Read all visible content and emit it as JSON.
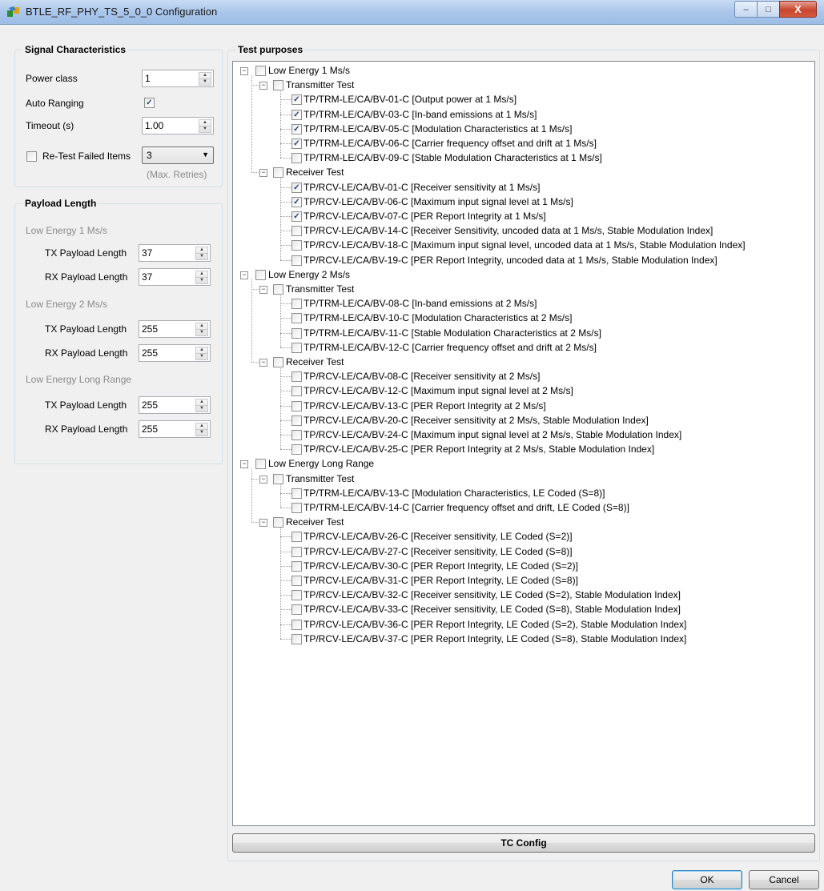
{
  "window": {
    "title": "BTLE_RF_PHY_TS_5_0_0 Configuration",
    "minimize": "–",
    "maximize": "□",
    "close": "X"
  },
  "signal": {
    "title": "Signal Characteristics",
    "power_class_label": "Power class",
    "power_class_value": "1",
    "auto_ranging_label": "Auto Ranging",
    "auto_ranging_checked": true,
    "timeout_label": "Timeout (s)",
    "timeout_value": "1.00",
    "retest_label": "Re-Test Failed Items",
    "retest_checked": false,
    "retest_value": "3",
    "max_retries": "(Max. Retries)"
  },
  "payload": {
    "title": "Payload Length",
    "groups": [
      {
        "name": "Low Energy 1 Ms/s",
        "tx_label": "TX Payload Length",
        "tx": "37",
        "rx_label": "RX Payload Length",
        "rx": "37"
      },
      {
        "name": "Low Energy 2 Ms/s",
        "tx_label": "TX Payload Length",
        "tx": "255",
        "rx_label": "RX Payload Length",
        "rx": "255"
      },
      {
        "name": "Low Energy Long Range",
        "tx_label": "TX Payload Length",
        "tx": "255",
        "rx_label": "RX Payload Length",
        "rx": "255"
      }
    ]
  },
  "tests": {
    "title": "Test purposes",
    "roots": [
      {
        "label": "Low Energy 1 Ms/s",
        "children": [
          {
            "label": "Transmitter Test",
            "items": [
              {
                "label": "TP/TRM-LE/CA/BV-01-C [Output power at 1 Ms/s]",
                "checked": true
              },
              {
                "label": "TP/TRM-LE/CA/BV-03-C [In-band emissions at 1 Ms/s]",
                "checked": true
              },
              {
                "label": "TP/TRM-LE/CA/BV-05-C [Modulation Characteristics at 1 Ms/s]",
                "checked": true
              },
              {
                "label": "TP/TRM-LE/CA/BV-06-C [Carrier frequency offset and drift at 1 Ms/s]",
                "checked": true
              },
              {
                "label": "TP/TRM-LE/CA/BV-09-C [Stable Modulation Characteristics at 1 Ms/s]",
                "checked": false
              }
            ]
          },
          {
            "label": "Receiver Test",
            "items": [
              {
                "label": "TP/RCV-LE/CA/BV-01-C [Receiver sensitivity at 1 Ms/s]",
                "checked": true
              },
              {
                "label": "TP/RCV-LE/CA/BV-06-C [Maximum input signal level at 1 Ms/s]",
                "checked": true
              },
              {
                "label": "TP/RCV-LE/CA/BV-07-C [PER Report Integrity at 1 Ms/s]",
                "checked": true
              },
              {
                "label": "TP/RCV-LE/CA/BV-14-C [Receiver Sensitivity, uncoded data at 1 Ms/s, Stable Modulation Index]",
                "checked": false
              },
              {
                "label": "TP/RCV-LE/CA/BV-18-C [Maximum input signal level, uncoded data at 1 Ms/s, Stable Modulation Index]",
                "checked": false
              },
              {
                "label": "TP/RCV-LE/CA/BV-19-C [PER Report Integrity, uncoded data at 1 Ms/s, Stable Modulation Index]",
                "checked": false
              }
            ]
          }
        ]
      },
      {
        "label": "Low Energy 2 Ms/s",
        "children": [
          {
            "label": "Transmitter Test",
            "items": [
              {
                "label": "TP/TRM-LE/CA/BV-08-C [In-band emissions at 2 Ms/s]",
                "checked": false
              },
              {
                "label": "TP/TRM-LE/CA/BV-10-C [Modulation Characteristics at 2 Ms/s]",
                "checked": false
              },
              {
                "label": "TP/TRM-LE/CA/BV-11-C [Stable Modulation Characteristics at 2 Ms/s]",
                "checked": false
              },
              {
                "label": "TP/TRM-LE/CA/BV-12-C [Carrier frequency offset and drift at 2 Ms/s]",
                "checked": false
              }
            ]
          },
          {
            "label": "Receiver Test",
            "items": [
              {
                "label": "TP/RCV-LE/CA/BV-08-C [Receiver sensitivity at 2 Ms/s]",
                "checked": false
              },
              {
                "label": "TP/RCV-LE/CA/BV-12-C [Maximum input signal level at 2 Ms/s]",
                "checked": false
              },
              {
                "label": "TP/RCV-LE/CA/BV-13-C [PER Report Integrity at 2 Ms/s]",
                "checked": false
              },
              {
                "label": "TP/RCV-LE/CA/BV-20-C [Receiver sensitivity at 2 Ms/s, Stable Modulation Index]",
                "checked": false
              },
              {
                "label": "TP/RCV-LE/CA/BV-24-C [Maximum input signal level at 2 Ms/s, Stable Modulation Index]",
                "checked": false
              },
              {
                "label": "TP/RCV-LE/CA/BV-25-C [PER Report Integrity at 2 Ms/s, Stable Modulation Index]",
                "checked": false
              }
            ]
          }
        ]
      },
      {
        "label": "Low Energy Long Range",
        "children": [
          {
            "label": "Transmitter Test",
            "items": [
              {
                "label": "TP/TRM-LE/CA/BV-13-C [Modulation Characteristics, LE Coded (S=8)]",
                "checked": false
              },
              {
                "label": "TP/TRM-LE/CA/BV-14-C [Carrier frequency offset and drift, LE Coded (S=8)]",
                "checked": false
              }
            ]
          },
          {
            "label": "Receiver Test",
            "items": [
              {
                "label": "TP/RCV-LE/CA/BV-26-C [Receiver sensitivity, LE Coded (S=2)]",
                "checked": false
              },
              {
                "label": "TP/RCV-LE/CA/BV-27-C [Receiver sensitivity, LE Coded (S=8)]",
                "checked": false
              },
              {
                "label": "TP/RCV-LE/CA/BV-30-C [PER Report Integrity, LE Coded (S=2)]",
                "checked": false
              },
              {
                "label": "TP/RCV-LE/CA/BV-31-C [PER Report Integrity, LE Coded (S=8)]",
                "checked": false
              },
              {
                "label": "TP/RCV-LE/CA/BV-32-C [Receiver sensitivity, LE Coded (S=2), Stable Modulation Index]",
                "checked": false
              },
              {
                "label": "TP/RCV-LE/CA/BV-33-C [Receiver sensitivity, LE Coded (S=8), Stable Modulation Index]",
                "checked": false
              },
              {
                "label": "TP/RCV-LE/CA/BV-36-C [PER Report Integrity, LE Coded (S=2), Stable Modulation Index]",
                "checked": false
              },
              {
                "label": "TP/RCV-LE/CA/BV-37-C [PER Report Integrity, LE Coded (S=8), Stable Modulation Index]",
                "checked": false
              }
            ]
          }
        ]
      }
    ]
  },
  "buttons": {
    "tc_config": "TC Config",
    "ok": "OK",
    "cancel": "Cancel"
  }
}
